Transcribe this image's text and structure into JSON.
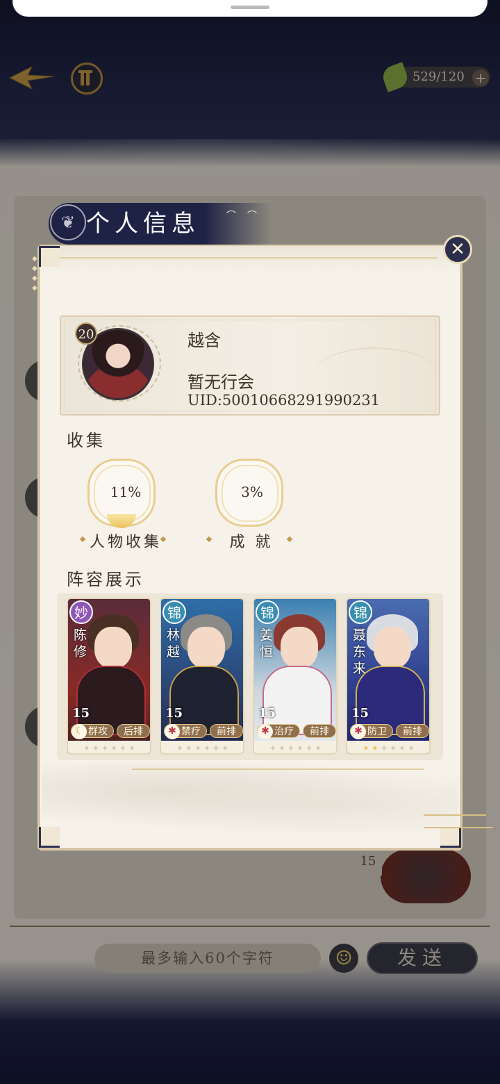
{
  "hud": {
    "resource_value": "529/120",
    "resource_plus": "+"
  },
  "panel": {
    "title": "个人信息",
    "close_label": "✕"
  },
  "profile": {
    "level": "20",
    "name": "越含",
    "guild": "暂无行会",
    "uid": "UID:50010668291990231"
  },
  "collection": {
    "heading": "收集",
    "stats": [
      {
        "value": "11%",
        "label": "人物收集"
      },
      {
        "value": "3%",
        "label": "成 就"
      }
    ]
  },
  "lineup": {
    "heading": "阵容展示",
    "heroes": [
      {
        "rarity": "妙",
        "name": "陈修",
        "level": "15",
        "role": "群攻",
        "position": "后排",
        "rarity_color": "#8f56b8",
        "role_icon": "☾"
      },
      {
        "rarity": "锦",
        "name": "林越",
        "level": "15",
        "role": "禁疗",
        "position": "前排",
        "rarity_color": "#3a8fb0",
        "role_icon": "✱"
      },
      {
        "rarity": "锦",
        "name": "姜恒",
        "level": "15",
        "role": "治疗",
        "position": "前排",
        "rarity_color": "#3a8fb0",
        "role_icon": "✱"
      },
      {
        "rarity": "锦",
        "name": "聂东来",
        "level": "15",
        "role": "防卫",
        "position": "前排",
        "rarity_color": "#3a8fb0",
        "role_icon": "✱"
      }
    ]
  },
  "chat": {
    "input_placeholder": "最多输入60个字符",
    "send_label": "发送",
    "background_card_level": "15"
  },
  "icons": {
    "back": "back-arrow-icon",
    "menu": "menu-emblem-icon",
    "resource": "leaf-icon",
    "emoji": "smiley-icon"
  }
}
